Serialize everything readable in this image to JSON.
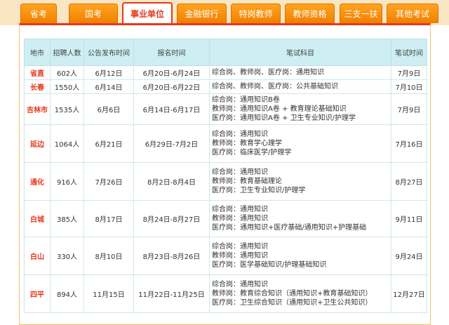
{
  "tabs": [
    "省考",
    "国考",
    "事业单位",
    "金融银行",
    "特岗教师",
    "教师资格",
    "三支一扶",
    "其他考试"
  ],
  "active_tab": 2,
  "headers": [
    "地市",
    "招聘人数",
    "公告发布时间",
    "报名时间",
    "笔试科目",
    "笔试时间"
  ],
  "rows": [
    {
      "city": "省直",
      "count": "602人",
      "announce": "6月12日",
      "signup": "6月20日-6月24日",
      "subjects": [
        "综合岗、教师岗、医疗岗：通用知识"
      ],
      "exam": "7月9日"
    },
    {
      "city": "长春",
      "count": "1550人",
      "announce": "6月14日",
      "signup": "6月20日-6月22日",
      "subjects": [
        "综合岗、教师岗、医疗岗：公共基础知识"
      ],
      "exam": "7月10日"
    },
    {
      "city": "吉林市",
      "count": "1535人",
      "announce": "6月6日",
      "signup": "6月14日-6月17日",
      "subjects": [
        "综合岗：通用知识B卷",
        "教师岗：通用知识A卷 + 教育理论基础知识",
        "医疗岗：通用知识A卷 + 卫生专业知识/护理学"
      ],
      "exam": "7月9日"
    },
    {
      "city": "延边",
      "count": "1064人",
      "announce": "6月21日",
      "signup": "6月29日-7月2日",
      "subjects": [
        "综合岗：通用知识",
        "教师岗：教育学心理学",
        "医疗岗：临床医学/护理学"
      ],
      "exam": "7月16日"
    },
    {
      "city": "通化",
      "count": "916人",
      "announce": "7月26日",
      "signup": "8月2日-8月4日",
      "subjects": [
        "综合岗：通用知识",
        "教师岗：教育基础理论",
        "医疗岗：卫生专业知识/护理学"
      ],
      "exam": "8月27日"
    },
    {
      "city": "白城",
      "count": "385人",
      "announce": "8月17日",
      "signup": "8月24日-8月27日",
      "subjects": [
        "综合岗：通用知识",
        "教师岗：通用知识",
        "医疗岗：通用知识+医疗基础/通用知识+护理基础"
      ],
      "exam": "9月11日"
    },
    {
      "city": "白山",
      "count": "330人",
      "announce": "8月10日",
      "signup": "8月23日-8月26日",
      "subjects": [
        "综合岗：通用知识",
        "教师岗：通用知识",
        "医疗岗：医学基础知识/护理基础知识"
      ],
      "exam": "9月24日"
    },
    {
      "city": "四平",
      "count": "894人",
      "announce": "11月15日",
      "signup": "11月22日-11月25日",
      "subjects": [
        "综合岗：通用知识",
        "教师岗：教育综合知识（通用知识+教育基础知识）",
        "医疗岗：卫生综合知识（通用知识+卫生公共知识）"
      ],
      "exam": "12月27日"
    }
  ]
}
